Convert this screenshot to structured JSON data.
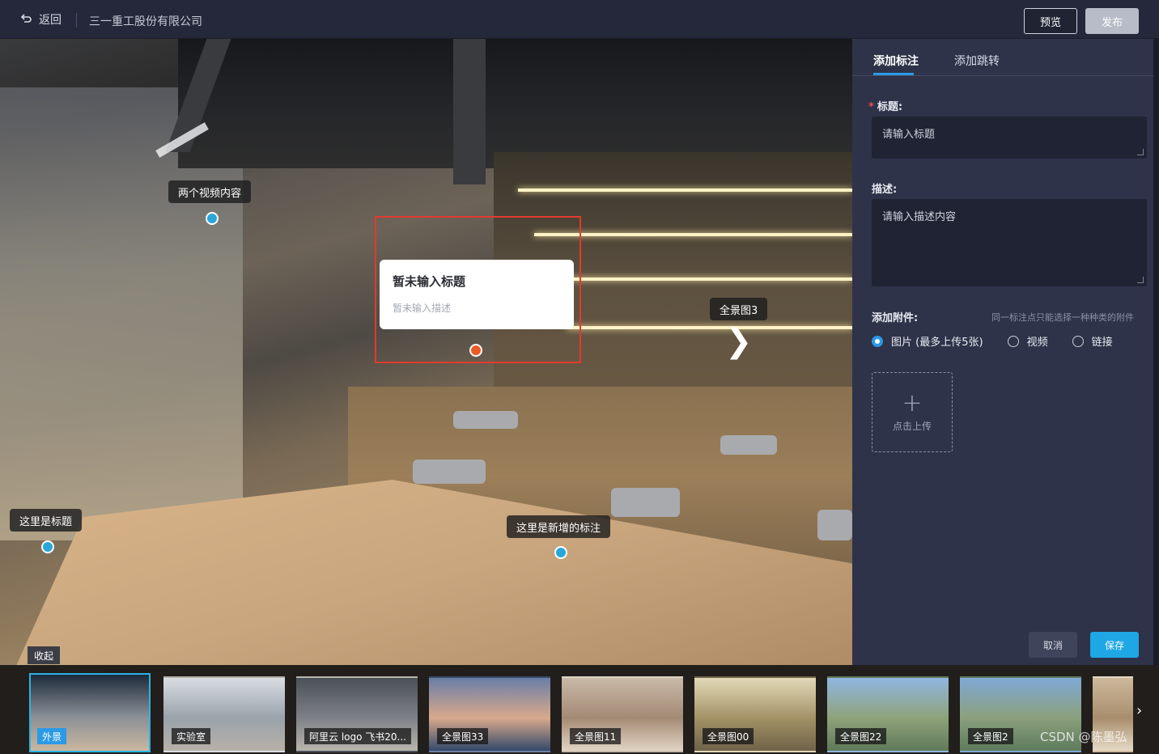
{
  "header": {
    "back_label": "返回",
    "company": "三一重工股份有限公司",
    "preview_label": "预览",
    "publish_label": "发布"
  },
  "viewer": {
    "hotspots": [
      {
        "label": "两个视频内容"
      },
      {
        "label": "这里是标题"
      },
      {
        "label": "这里是新增的标注"
      }
    ],
    "scene_link_label": "全景图3",
    "scene_link_arrow": "❯",
    "popup": {
      "title": "暂未输入标题",
      "description": "暂未输入描述"
    },
    "collapse_label": "收起"
  },
  "side_panel": {
    "tabs": [
      "添加标注",
      "添加跳转"
    ],
    "active_tab": "添加标注",
    "title_label": "标题:",
    "title_required_mark": "*",
    "title_placeholder": "请输入标题",
    "desc_label": "描述:",
    "desc_placeholder": "请输入描述内容",
    "attach_label": "添加附件:",
    "attach_hint": "同一标注点只能选择一种种类的附件",
    "attach_types": [
      {
        "label": "图片 (最多上传5张)",
        "selected": true
      },
      {
        "label": "视频",
        "selected": false
      },
      {
        "label": "链接",
        "selected": false
      }
    ],
    "upload_plus": "+",
    "upload_label": "点击上传",
    "cancel_label": "取消",
    "save_label": "保存"
  },
  "scenes": [
    {
      "label": "外景",
      "active": true,
      "colors": [
        "#1d2a3a",
        "#8a8f96",
        "#c9b7a0"
      ]
    },
    {
      "label": "实验室",
      "active": false,
      "colors": [
        "#d9dde2",
        "#9aa3ab",
        "#b7b0a8"
      ]
    },
    {
      "label": "阿里云 logo 飞书20...",
      "active": false,
      "colors": [
        "#4b4f57",
        "#7e8187",
        "#b8b4ad"
      ]
    },
    {
      "label": "全景图33",
      "active": false,
      "colors": [
        "#6a7ea6",
        "#d9a98c",
        "#33496b"
      ]
    },
    {
      "label": "全景图11",
      "active": false,
      "colors": [
        "#c8b9a8",
        "#a48a74",
        "#e1d4c3"
      ]
    },
    {
      "label": "全景图00",
      "active": false,
      "colors": [
        "#e3d9b8",
        "#a39266",
        "#6f6248"
      ]
    },
    {
      "label": "全景图22",
      "active": false,
      "colors": [
        "#8fb7e0",
        "#8fa27a",
        "#5f7a5a"
      ]
    },
    {
      "label": "全景图2",
      "active": false,
      "colors": [
        "#7fa9d6",
        "#8ba07c",
        "#5d7b5d"
      ]
    },
    {
      "label": "",
      "active": false,
      "colors": [
        "#cdb99c",
        "#a88d6c",
        "#e6dac6"
      ]
    }
  ],
  "strip_next_icon": "›",
  "watermark": "CSDN @陈墨弘"
}
